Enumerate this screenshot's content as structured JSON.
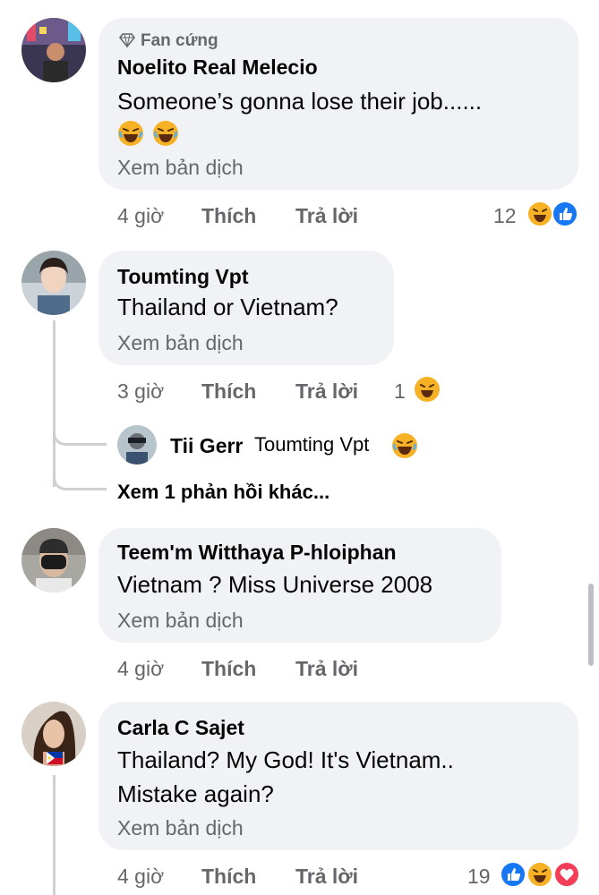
{
  "comments": [
    {
      "badge": "Fan cứng",
      "author": "Noelito Real Melecio",
      "text": "Someone’s gonna lose their job......",
      "translate": "Xem bản dịch",
      "time": "4 giờ",
      "like": "Thích",
      "reply": "Trả lời",
      "reaction_count": "12",
      "reactions": [
        "haha-icon",
        "like-icon"
      ]
    },
    {
      "author": "Toumting Vpt",
      "text": "Thailand or Vietnam?",
      "translate": "Xem bản dịch",
      "time": "3 giờ",
      "like": "Thích",
      "reply": "Trả lời",
      "reaction_count": "1",
      "reactions": [
        "haha-icon"
      ],
      "reply_preview": {
        "author": "Tii Gerr",
        "text": "Toumting Vpt",
        "reactions": [
          "haha-icon"
        ]
      },
      "more_replies": "Xem 1 phản hồi khác..."
    },
    {
      "author": "Teem'm Witthaya P-hloiphan",
      "text": "Vietnam ? Miss Universe 2008",
      "translate": "Xem bản dịch",
      "time": "4 giờ",
      "like": "Thích",
      "reply": "Trả lời"
    },
    {
      "author": "Carla C Sajet",
      "text_line1": "Thailand? My God! It's Vietnam..",
      "text_line2": "Mistake again?",
      "translate": "Xem bản dịch",
      "time": "4 giờ",
      "like": "Thích",
      "reply": "Trả lời",
      "reaction_count": "19",
      "reactions": [
        "like-icon",
        "haha-icon",
        "love-icon"
      ]
    }
  ],
  "colors": {
    "bubble": "#f0f2f5",
    "secondary_text": "#65676b",
    "like_blue": "#1877f2",
    "haha_yellow": "#f7b125",
    "love_red": "#f33e58"
  }
}
